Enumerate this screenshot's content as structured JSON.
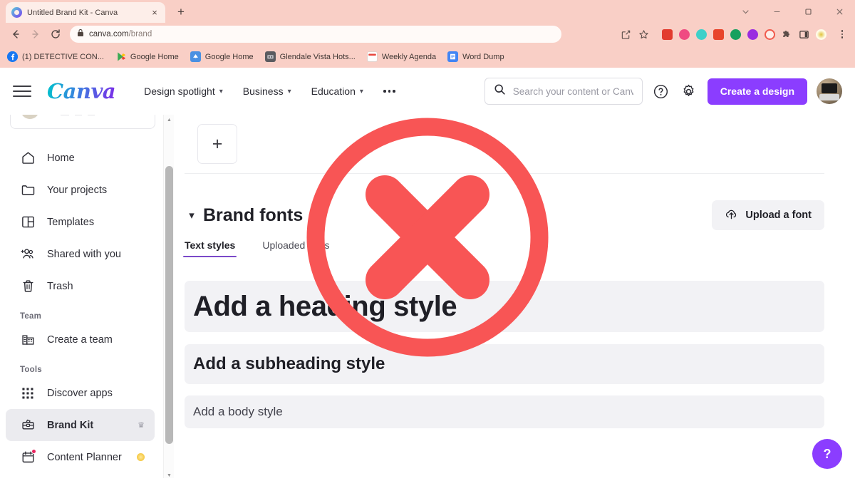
{
  "browser": {
    "tab": {
      "title": "Untitled Brand Kit - Canva",
      "close_label": "×",
      "favicon": "canva-favicon"
    },
    "new_tab_label": "+",
    "window_controls": [
      {
        "name": "chevron-down",
        "glyph": "⌄"
      },
      {
        "name": "minimize",
        "glyph": "—"
      },
      {
        "name": "maximize",
        "glyph": "❐"
      },
      {
        "name": "close",
        "glyph": "✕"
      }
    ],
    "url": {
      "host": "canva.com",
      "path": "/brand",
      "full": "canva.com/brand"
    },
    "nav": {
      "back": "←",
      "forward": "→",
      "reload": "↻"
    },
    "omnibox_actions": [
      {
        "name": "share-icon"
      },
      {
        "name": "bookmark-star-icon"
      }
    ],
    "extensions": [
      {
        "name": "extension-red-square",
        "color": "#e23b2e",
        "shape": "square"
      },
      {
        "name": "extension-pink-circle",
        "color": "#ef4b82",
        "shape": "round"
      },
      {
        "name": "extension-teal-circle",
        "color": "#3fd0c9",
        "shape": "round"
      },
      {
        "name": "extension-orange-square",
        "color": "#e8442b",
        "shape": "square"
      },
      {
        "name": "extension-green-circle",
        "color": "#18a05e",
        "shape": "round"
      },
      {
        "name": "extension-purple-circle",
        "color": "#9b2ce0",
        "shape": "round"
      },
      {
        "name": "extension-opera-circle",
        "color": "#f05a4c",
        "shape": "round"
      },
      {
        "name": "extension-puzzle-icon",
        "color": "#5c4d48",
        "shape": "square"
      },
      {
        "name": "extension-sidepanel-icon",
        "color": "#4a3f3c",
        "shape": "square"
      },
      {
        "name": "extension-yellow-dot",
        "color": "#fffbe0",
        "shape": "round"
      }
    ],
    "menu_label": "⋮",
    "bookmarks": [
      {
        "label": "(1) DETECTIVE CON...",
        "icon": "facebook-icon",
        "color": "#1877f2"
      },
      {
        "label": "Google Home",
        "icon": "play-store-icon",
        "color": "#34a853"
      },
      {
        "label": "Google Home",
        "icon": "google-home-icon",
        "color": "#4285f4"
      },
      {
        "label": "Glendale Vista Hots...",
        "icon": "hotel-icon",
        "color": "#5b5b60"
      },
      {
        "label": "Weekly Agenda",
        "icon": "calendar-icon",
        "color": "#e8453c"
      },
      {
        "label": "Word Dump",
        "icon": "docs-icon",
        "color": "#4285f4"
      }
    ]
  },
  "canva": {
    "brand": "Canva",
    "hamburger_label": "menu",
    "nav_links": [
      {
        "label": "Design spotlight",
        "has_chevron": true
      },
      {
        "label": "Business",
        "has_chevron": true
      },
      {
        "label": "Education",
        "has_chevron": true
      }
    ],
    "more_label": "more",
    "search": {
      "placeholder": "Search your content or Canva",
      "value": ""
    },
    "help_icon_label": "?",
    "settings_icon_label": "settings",
    "create_button": "Create a design",
    "avatar_label": "user-avatar",
    "help_fab": "?"
  },
  "sidebar": {
    "items": [
      {
        "label": "Home",
        "icon": "home-icon",
        "active": false
      },
      {
        "label": "Your projects",
        "icon": "folder-icon",
        "active": false
      },
      {
        "label": "Templates",
        "icon": "templates-icon",
        "active": false
      },
      {
        "label": "Shared with you",
        "icon": "shared-users-icon",
        "active": false
      },
      {
        "label": "Trash",
        "icon": "trash-icon",
        "active": false
      }
    ],
    "team_section": "Team",
    "team_items": [
      {
        "label": "Create a team",
        "icon": "building-icon",
        "active": false
      }
    ],
    "tools_section": "Tools",
    "tools_items": [
      {
        "label": "Discover apps",
        "icon": "grid-apps-icon",
        "active": false,
        "badge": "none"
      },
      {
        "label": "Brand Kit",
        "icon": "brand-kit-icon",
        "active": true,
        "badge": "crown"
      },
      {
        "label": "Content Planner",
        "icon": "calendar-plan-icon",
        "active": false,
        "badge": "dot"
      }
    ],
    "scroll": {
      "up_arrow": "▲",
      "down_arrow": "▼"
    }
  },
  "main": {
    "add_color_label": "+",
    "brand_fonts": {
      "collapse_chevron": "⌄",
      "title": "Brand fonts",
      "upload_button": "Upload a font",
      "upload_icon": "cloud-upload-icon"
    },
    "tabs": [
      {
        "label": "Text styles",
        "active": true
      },
      {
        "label": "Uploaded fonts",
        "active": false
      }
    ],
    "styles": [
      {
        "label": "Add a heading style",
        "kind": "heading"
      },
      {
        "label": "Add a subheading style",
        "kind": "subheading"
      },
      {
        "label": "Add a body style",
        "kind": "body"
      }
    ]
  },
  "overlay": {
    "type": "red-x-circle",
    "color": "#f85555",
    "meaning": "prohibited-action-marker"
  },
  "colors": {
    "accent_purple": "#8b3dff",
    "tab_underline": "#7a49c9",
    "overlay_red": "#f85555",
    "chrome_pink": "#f9cfc6",
    "style_row_bg": "#f2f2f5"
  }
}
